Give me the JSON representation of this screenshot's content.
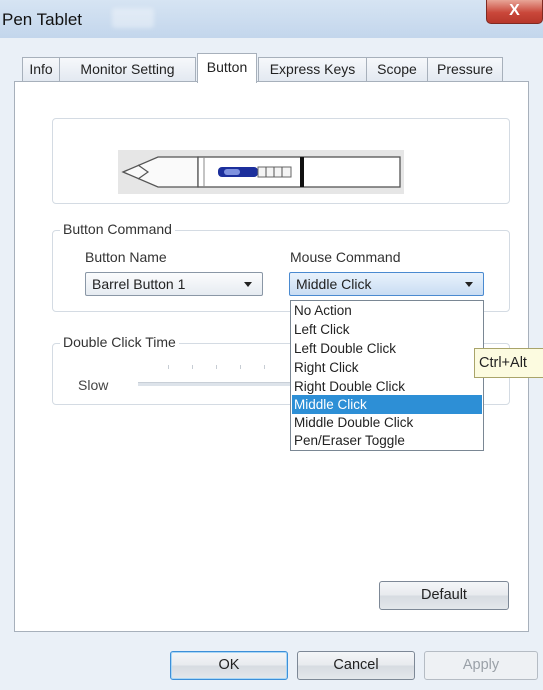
{
  "window": {
    "title": "Pen Tablet",
    "close_glyph": "X"
  },
  "tabs": [
    {
      "label": "Info"
    },
    {
      "label": "Monitor Setting"
    },
    {
      "label": "Button"
    },
    {
      "label": "Express Keys"
    },
    {
      "label": "Scope"
    },
    {
      "label": "Pressure"
    }
  ],
  "active_tab": "Button",
  "button_command": {
    "group_label": "Button Command",
    "button_name_label": "Button Name",
    "button_name_value": "Barrel Button 1",
    "mouse_command_label": "Mouse Command",
    "mouse_command_value": "Middle Click",
    "options": [
      "No Action",
      "Left Click",
      "Left Double Click",
      "Right Click",
      "Right Double Click",
      "Middle Click",
      "Middle Double Click",
      "Pen/Eraser Toggle"
    ],
    "selected_index": 5
  },
  "double_click": {
    "group_label": "Double Click Time",
    "slow_label": "Slow"
  },
  "tooltip": "Ctrl+Alt",
  "buttons": {
    "default": "Default",
    "ok": "OK",
    "cancel": "Cancel",
    "apply": "Apply"
  },
  "colors": {
    "selection": "#2d8fd6",
    "close_button": "#c9473a",
    "tooltip_bg": "#fcfbe0"
  },
  "icons": {
    "pen": "pen-illustration",
    "dropdown_arrow": "chevron-down-icon",
    "close": "close-icon"
  }
}
